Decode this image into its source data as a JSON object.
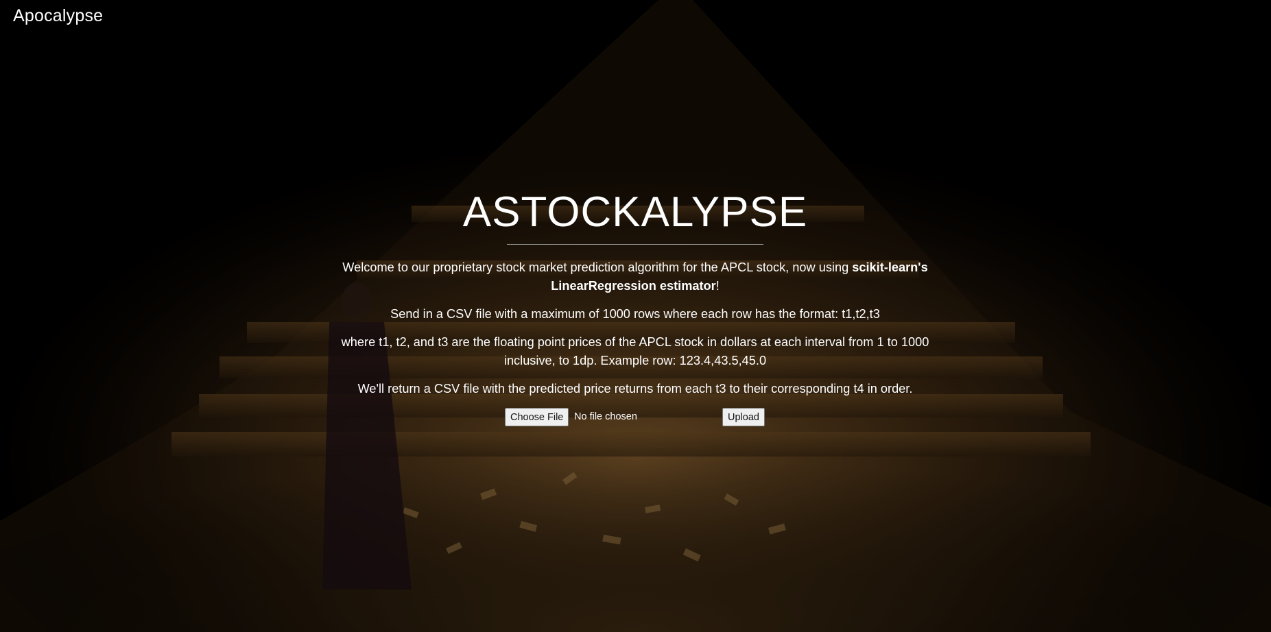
{
  "brand": {
    "name": "Apocalypse"
  },
  "hero": {
    "title": "ASTOCKALYPSE",
    "intro_prefix": "Welcome to our proprietary stock market prediction algorithm for the APCL stock, now using ",
    "intro_bold": "scikit-learn's LinearRegression estimator",
    "intro_suffix": "!",
    "format_text": "Send in a CSV file with a maximum of 1000 rows where each row has the format: t1,t2,t3",
    "where_text": "where t1, t2, and t3 are the floating point prices of the APCL stock in dollars at each interval from 1 to 1000 inclusive, to 1dp. Example row: 123.4,43.5,45.0",
    "return_text": "We'll return a CSV file with the predicted price returns from each t3 to their corresponding t4 in order."
  },
  "form": {
    "choose_file_label": "Choose File",
    "file_status": "No file chosen",
    "upload_label": "Upload"
  },
  "colors": {
    "background": "#000000",
    "text": "#ffffff",
    "rule": "#9a9a9a",
    "glow": "#7a5523"
  }
}
